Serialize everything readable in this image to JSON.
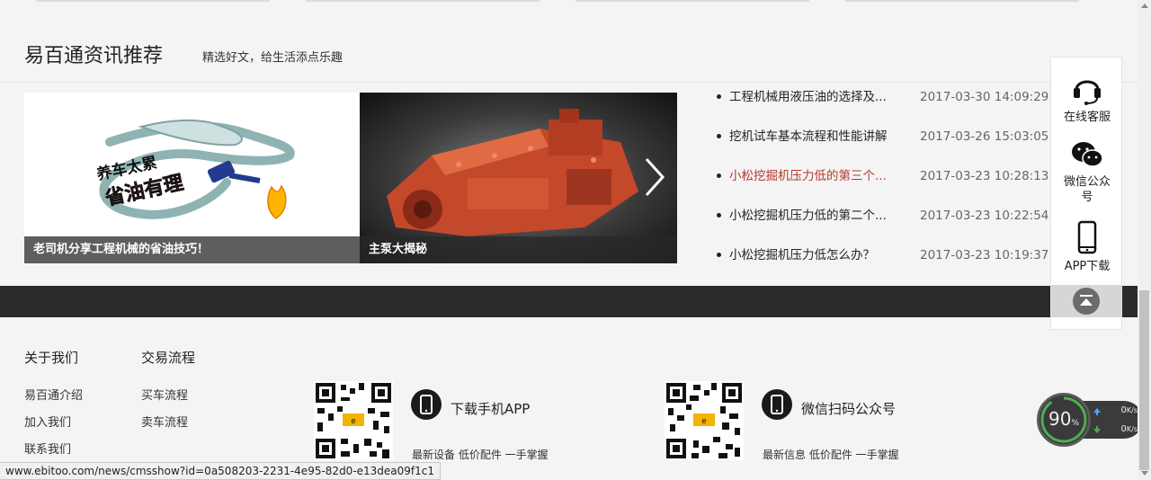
{
  "section": {
    "title": "易百通资讯推荐",
    "subtitle": "精选好文，给生活添点乐趣"
  },
  "slides": [
    {
      "caption": "老司机分享工程机械的省油技巧！",
      "art_text_1": "养车太累",
      "art_text_2": "省油有理"
    },
    {
      "caption": "主泵大揭秘"
    }
  ],
  "news": [
    {
      "title": "工程机械用液压油的选择及...",
      "date": "2017-03-30 14:09:29",
      "highlight": false
    },
    {
      "title": "挖机试车基本流程和性能讲解",
      "date": "2017-03-26 15:03:05",
      "highlight": false
    },
    {
      "title": "小松挖掘机压力低的第三个...",
      "date": "2017-03-23 10:28:13",
      "highlight": true
    },
    {
      "title": "小松挖掘机压力低的第二个...",
      "date": "2017-03-23 10:22:54",
      "highlight": false
    },
    {
      "title": "小松挖掘机压力低怎么办？",
      "date": "2017-03-23 10:19:37",
      "highlight": false
    }
  ],
  "footer": {
    "col1": {
      "heading": "关于我们",
      "links": [
        "易百通介绍",
        "加入我们",
        "联系我们"
      ]
    },
    "col2": {
      "heading": "交易流程",
      "links": [
        "买车流程",
        "卖车流程"
      ]
    },
    "app": {
      "title": "下载手机APP",
      "sub": "最新设备 低价配件 一手掌握"
    },
    "wechat": {
      "title": "微信扫码公众号",
      "sub": "最新信息 低价配件 一手掌握"
    }
  },
  "sidebar": {
    "service": "在线客服",
    "wechat": "微信公众号",
    "app": "APP下载"
  },
  "speed": {
    "percent": "90",
    "percent_unit": "%",
    "up": "0",
    "down": "0",
    "unit": "K/s"
  },
  "status_url": "www.ebitoo.com/news/cmsshow?id=0a508203-2231-4e95-82d0-e13dea09f1c1",
  "colors": {
    "highlight": "#b23a2b",
    "dark_band": "#2c292a"
  }
}
